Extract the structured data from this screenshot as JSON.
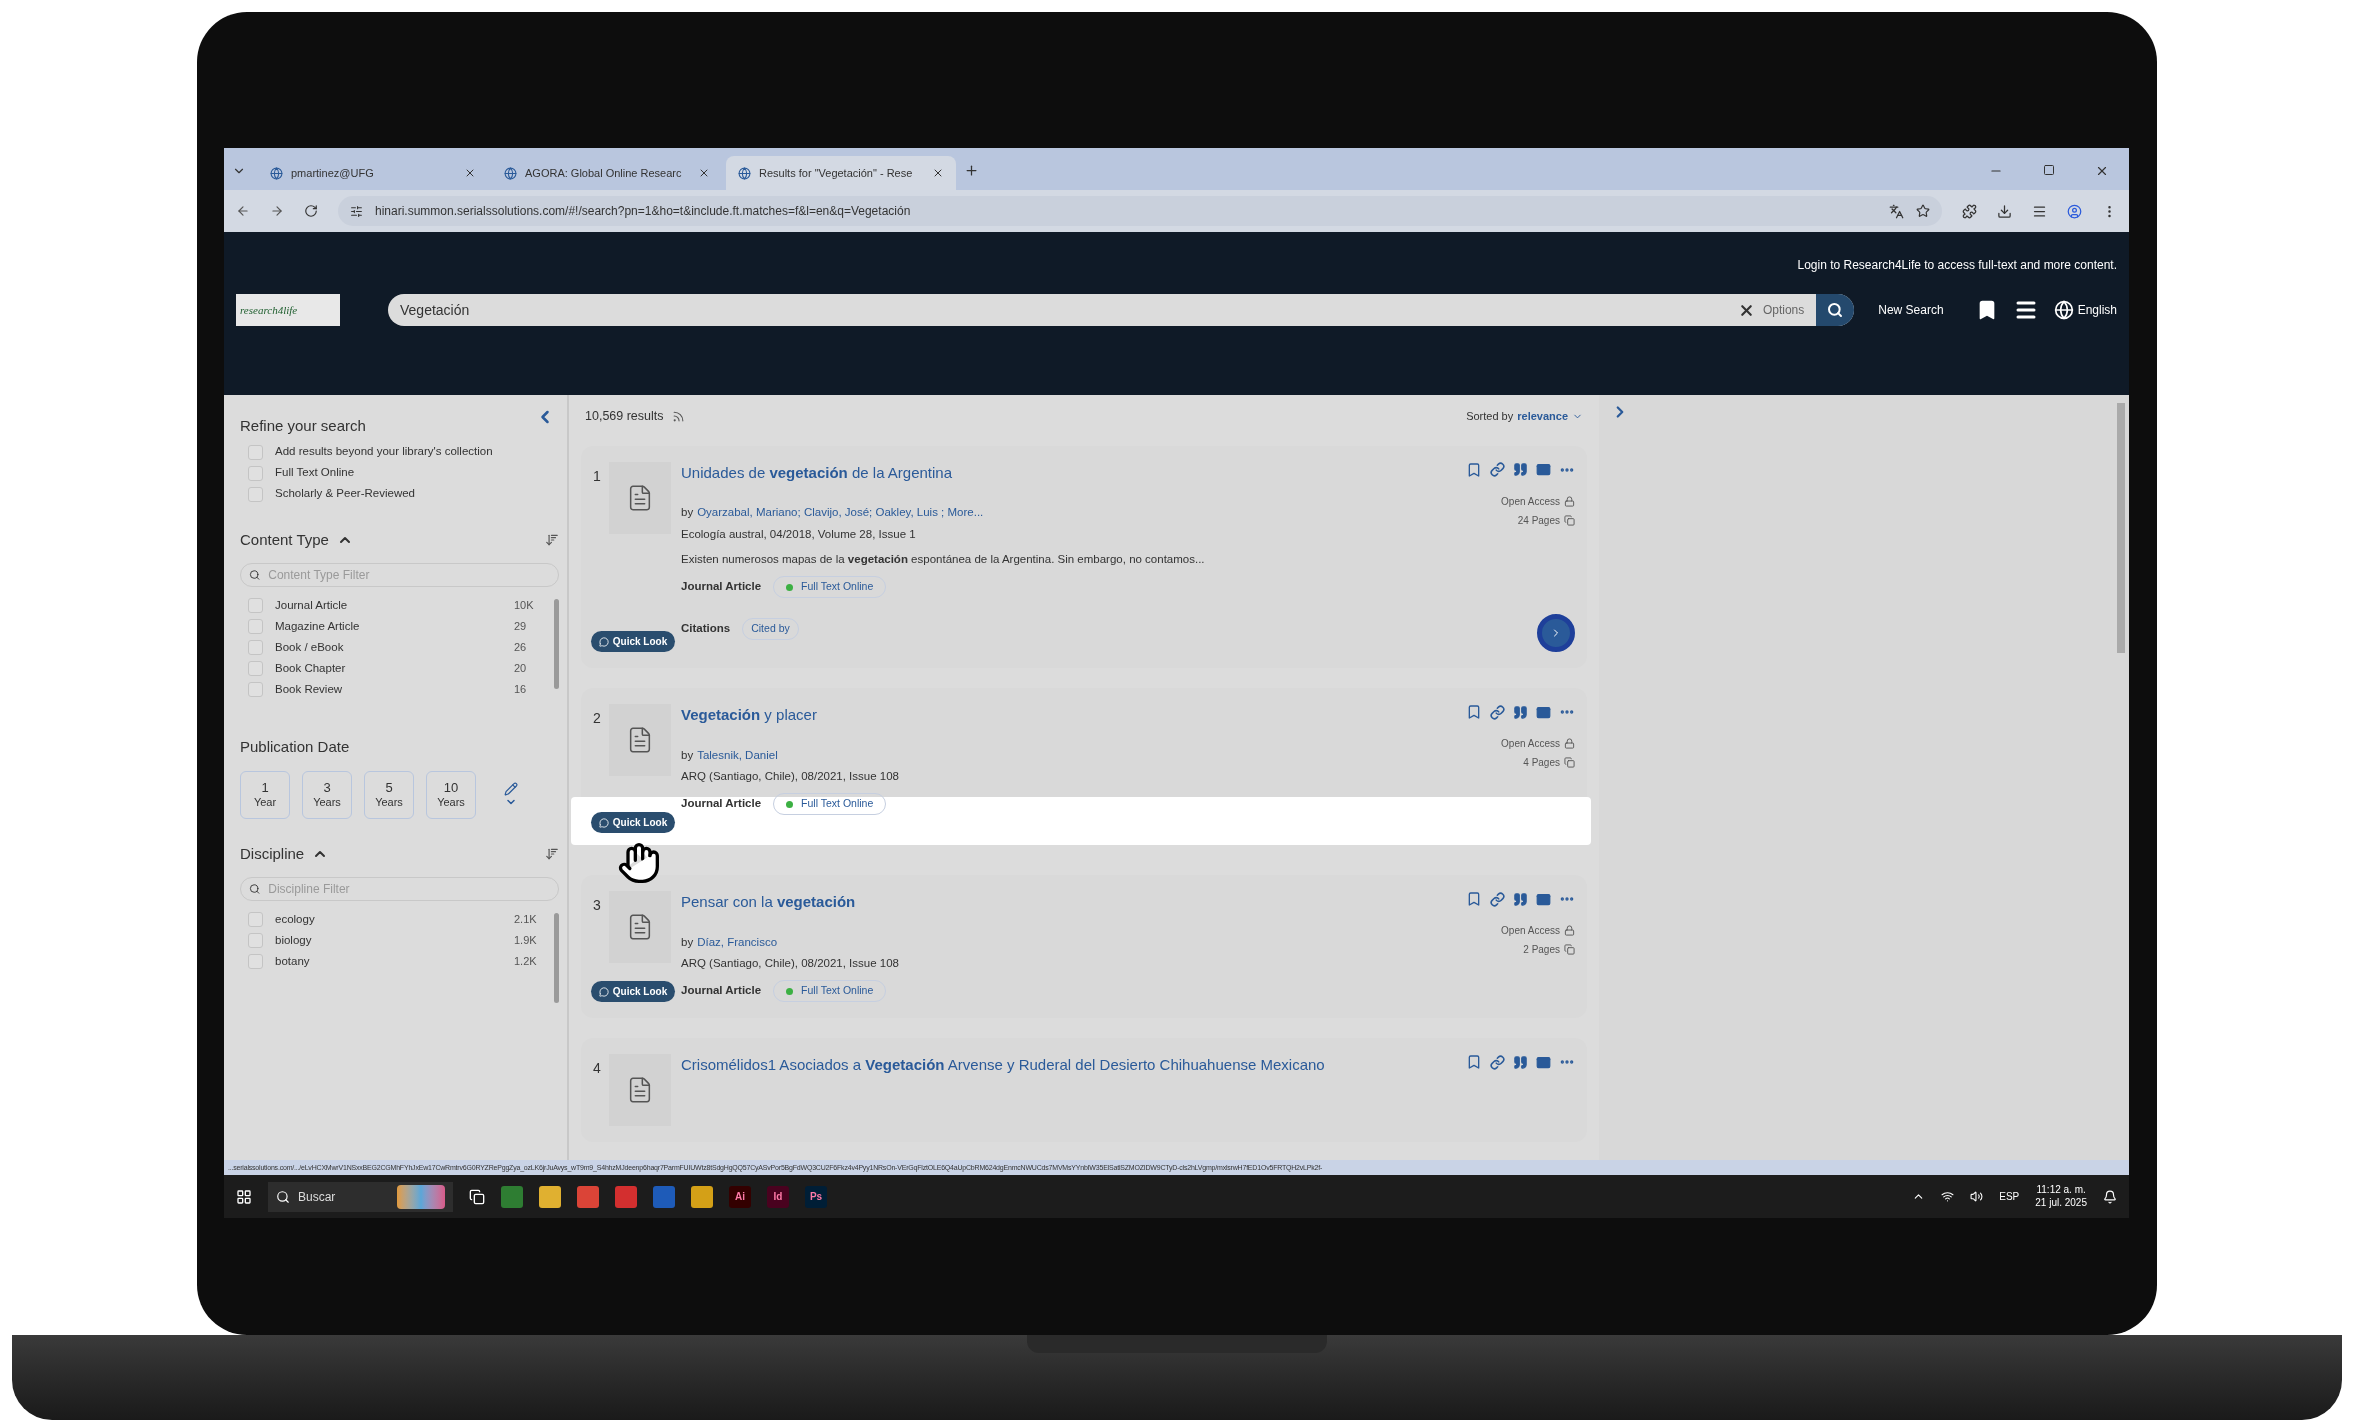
{
  "browser": {
    "tabs": [
      {
        "title": "pmartinez@UFG",
        "selected": false
      },
      {
        "title": "AGORA: Global Online Researc",
        "selected": false
      },
      {
        "title": "Results for \"Vegetación\" - Rese",
        "selected": true
      }
    ],
    "url": "hinari.summon.serialssolutions.com/#!/search?pn=1&ho=t&include.ft.matches=f&l=en&q=Vegetación"
  },
  "header": {
    "login_prompt": "Login to Research4Life to access full-text and more content.",
    "logo_text": "research4life",
    "search_value": "Vegetación",
    "options_label": "Options",
    "new_search_label": "New Search",
    "language": "English"
  },
  "sidebar": {
    "title": "Refine your search",
    "filters": [
      {
        "label": "Add results beyond your library's collection",
        "checked": false
      },
      {
        "label": "Full Text Online",
        "checked": false
      },
      {
        "label": "Scholarly & Peer-Reviewed",
        "checked": false
      }
    ],
    "content_type": {
      "title": "Content Type",
      "placeholder": "Content Type Filter",
      "items": [
        {
          "label": "Journal Article",
          "count": "10K",
          "checked": false
        },
        {
          "label": "Magazine Article",
          "count": "29",
          "checked": false
        },
        {
          "label": "Book / eBook",
          "count": "26",
          "checked": false
        },
        {
          "label": "Book Chapter",
          "count": "20",
          "checked": false
        },
        {
          "label": "Book Review",
          "count": "16",
          "checked": false
        }
      ]
    },
    "publication_date": {
      "title": "Publication Date",
      "options": [
        {
          "number": "1",
          "unit": "Year"
        },
        {
          "number": "3",
          "unit": "Years"
        },
        {
          "number": "5",
          "unit": "Years"
        },
        {
          "number": "10",
          "unit": "Years"
        }
      ]
    },
    "discipline": {
      "title": "Discipline",
      "placeholder": "Discipline Filter",
      "items": [
        {
          "label": "ecology",
          "count": "2.1K",
          "checked": false
        },
        {
          "label": "biology",
          "count": "1.9K",
          "checked": false
        },
        {
          "label": "botany",
          "count": "1.2K",
          "checked": false
        }
      ]
    }
  },
  "results": {
    "count": "10,569 results",
    "sorted_by": "Sorted by",
    "sort_value": "relevance",
    "items": [
      {
        "number": "1",
        "title": "Unidades de **vegetación** de la Argentina",
        "by": "by",
        "authors": "Oyarzabal, Mariano; Clavijo, José; Oakley, Luis ; More...",
        "source": "Ecología austral, 04/2018, Volume 28, Issue 1",
        "snippet": "Existen numerosos mapas de la **vegetación** espontánea de la Argentina. Sin embargo, no contamos...",
        "type": "Journal Article",
        "availability": "Full Text Online",
        "access": "Open Access",
        "pages": "24 Pages",
        "citations_label": "Citations",
        "cited_by": "Cited by",
        "quick_look": "Quick Look",
        "hovered": false
      },
      {
        "number": "2",
        "title": "**Vegetación** y placer",
        "by": "by",
        "authors": "Talesnik, Daniel",
        "source": "ARQ (Santiago, Chile), 08/2021, Issue 108",
        "type": "Journal Article",
        "availability": "Full Text Online",
        "access": "Open Access",
        "pages": "4 Pages",
        "quick_look": "Quick Look",
        "hovered": true
      },
      {
        "number": "3",
        "title": "Pensar con la **vegetación**",
        "by": "by",
        "authors": "Díaz, Francisco",
        "source": "ARQ (Santiago, Chile), 08/2021, Issue 108",
        "type": "Journal Article",
        "availability": "Full Text Online",
        "access": "Open Access",
        "pages": "2 Pages",
        "quick_look": "Quick Look",
        "hovered": false
      },
      {
        "number": "4",
        "title": "Crisomélidos1 Asociados a **Vegetación** Arvense y Ruderal del Desierto Chihuahuense Mexicano",
        "hovered": false
      }
    ]
  },
  "status_url": "...serialssolutions.com/.../eLvHCXMwrV1NSxxBEG2CGMhFYhJxEw17CwRmtrv6G0RYZRePggZya_ozLK6jrJuAvys_wT9m9_S4hhzMJdeenp6haqr7ParmFUIUWtz8tSdgHgQQ57CyASvPor5BgFdWQ3CU2F6Fkz4v4Pyy1NRsOn-VErGqFlztOLE6Q4aUpCbRM624dgEnmcNWUCds7MVMsYYnbIW35ElSatlSZMOZIDW9CTyD-cls2hLVgmp/mxlsrwH7fED1Ov5FRTQH2vLPk2f-",
  "taskbar": {
    "search_placeholder": "Buscar",
    "apps": [
      {
        "color": "#2e7d32"
      },
      {
        "color": "#e0b030"
      },
      {
        "color": "#db4437"
      },
      {
        "color": "#d32f2f"
      },
      {
        "color": "#1e5bb8"
      },
      {
        "color": "#d4a017"
      },
      {
        "label": "Ai",
        "color": "#330000"
      },
      {
        "label": "Id",
        "color": "#49021f"
      },
      {
        "label": "Ps",
        "color": "#001e36"
      }
    ],
    "language": "ESP",
    "time": "11:12 a. m.",
    "date": "21 jul. 2025"
  }
}
